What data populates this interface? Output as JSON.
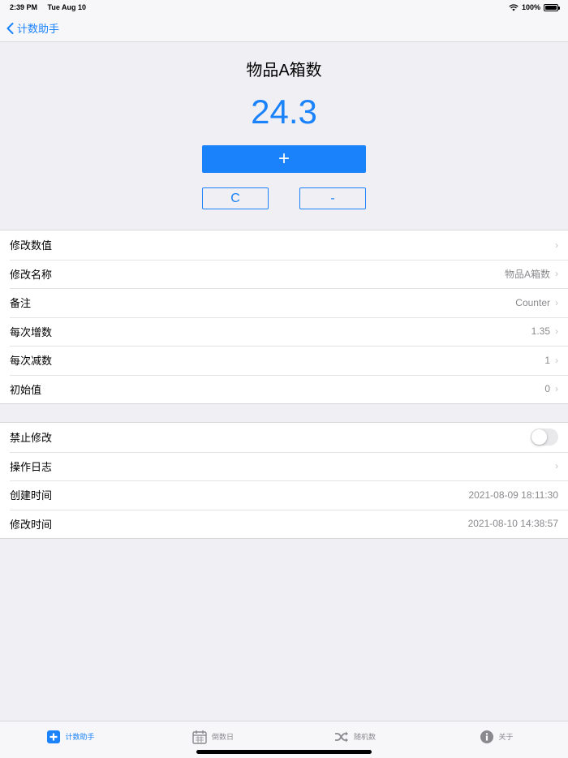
{
  "status_bar": {
    "time": "2:39 PM",
    "date": "Tue Aug 10",
    "battery": "100%"
  },
  "nav": {
    "back_label": "计数助手"
  },
  "counter": {
    "title": "物品A箱数",
    "value": "24.3",
    "plus_label": "+",
    "clear_label": "C",
    "minus_label": "-"
  },
  "settings_group1": [
    {
      "label": "修改数值",
      "value": ""
    },
    {
      "label": "修改名称",
      "value": "物品A箱数"
    },
    {
      "label": "备注",
      "value": "Counter"
    },
    {
      "label": "每次增数",
      "value": "1.35"
    },
    {
      "label": "每次减数",
      "value": "1"
    },
    {
      "label": "初始值",
      "value": "0"
    }
  ],
  "settings_group2": {
    "lock": {
      "label": "禁止修改",
      "enabled": false
    },
    "log": {
      "label": "操作日志"
    },
    "created": {
      "label": "创建时间",
      "value": "2021-08-09 18:11:30"
    },
    "modified": {
      "label": "修改时间",
      "value": "2021-08-10 14:38:57"
    }
  },
  "tabs": [
    {
      "label": "计数助手",
      "icon": "plus-square-icon",
      "active": true
    },
    {
      "label": "倒数日",
      "icon": "calendar-icon",
      "active": false
    },
    {
      "label": "随机数",
      "icon": "shuffle-icon",
      "active": false
    },
    {
      "label": "关于",
      "icon": "info-icon",
      "active": false
    }
  ],
  "colors": {
    "accent": "#1a82fb",
    "background": "#efeff4"
  }
}
